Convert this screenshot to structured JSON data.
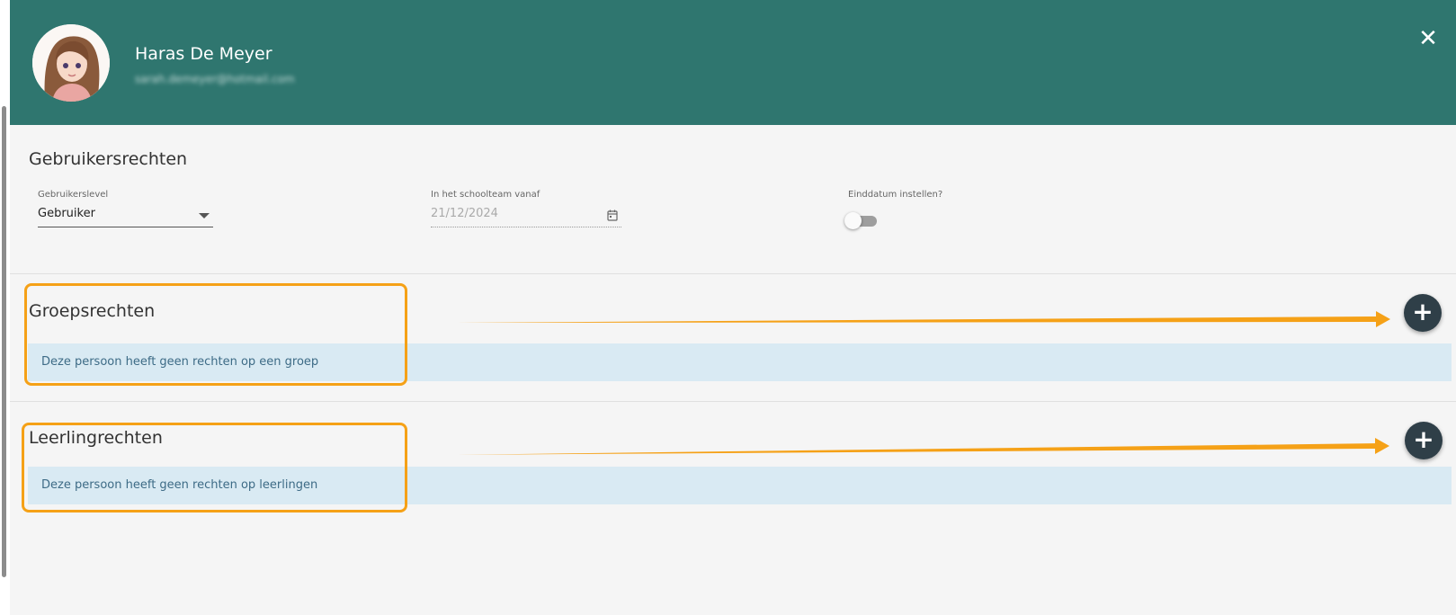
{
  "profile": {
    "name": "Haras De Meyer",
    "email": "sarah.demeyer@hotmail.com"
  },
  "header": {
    "close_glyph": "✕",
    "close_icon": "close-icon"
  },
  "user_rights": {
    "title": "Gebruikersrechten",
    "level_label": "Gebruikerslevel",
    "level_value": "Gebruiker",
    "start_label": "In het schoolteam vanaf",
    "start_value": "21/12/2024",
    "end_label": "Einddatum instellen?",
    "end_enabled": false
  },
  "group_rights": {
    "title": "Groepsrechten",
    "empty_message": "Deze persoon heeft geen rechten op een groep",
    "add_glyph": "+"
  },
  "student_rights": {
    "title": "Leerlingrechten",
    "empty_message": "Deze persoon heeft geen rechten op leerlingen",
    "add_glyph": "+"
  },
  "colors": {
    "header": "#2f766f",
    "fab": "#2f3f48",
    "info_bar": "#d9eaf3",
    "annotation": "#f5a117"
  }
}
